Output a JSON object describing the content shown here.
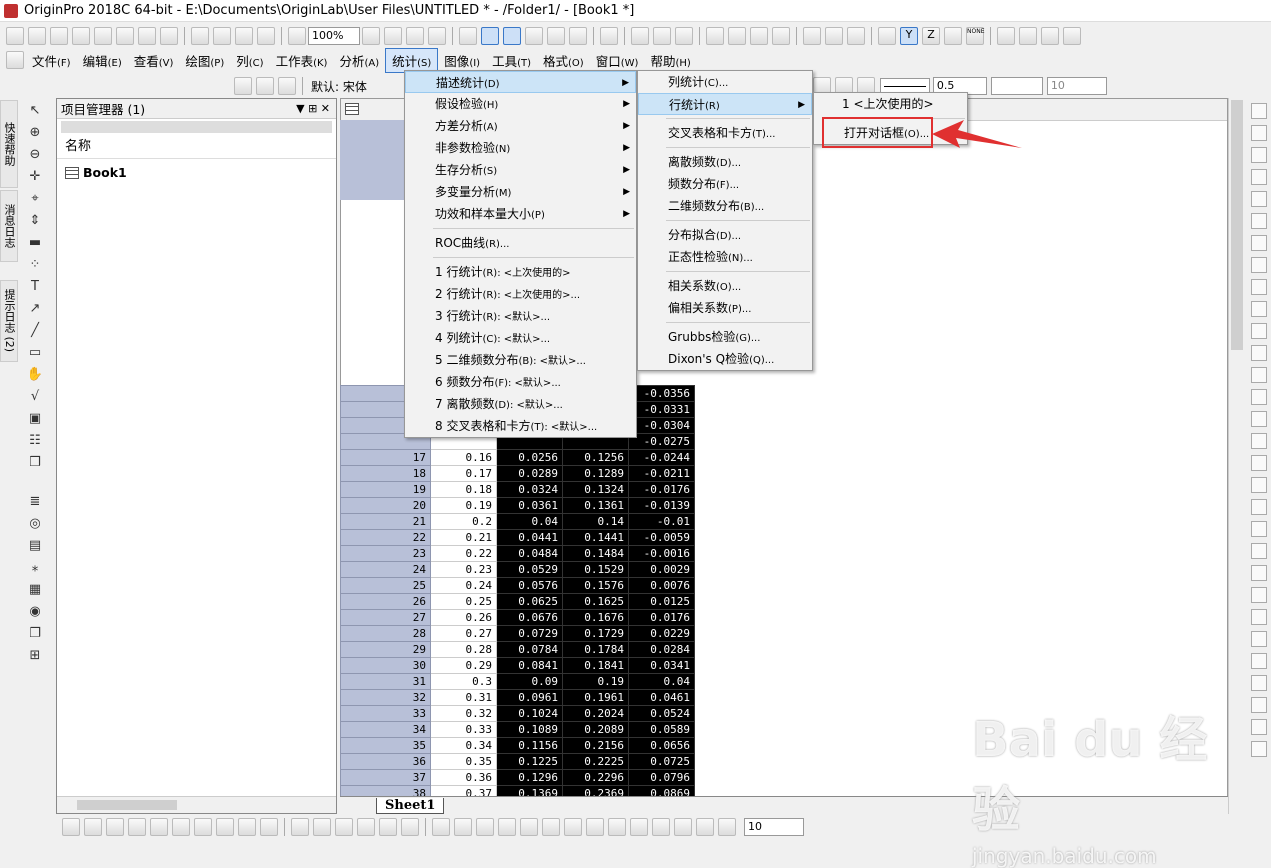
{
  "window": {
    "title": "OriginPro 2018C 64-bit - E:\\Documents\\OriginLab\\User Files\\UNTITLED * - /Folder1/ - [Book1 *]"
  },
  "toolbar": {
    "zoom": "100%",
    "font_name": "默认: 宋体",
    "line_width": "0.5",
    "bottom_size": "10",
    "letter_z": "Z",
    "letter_y": "Y",
    "none_label": "NONE"
  },
  "menubar": [
    {
      "label": "文件",
      "key": "(F)"
    },
    {
      "label": "编辑",
      "key": "(E)"
    },
    {
      "label": "查看",
      "key": "(V)"
    },
    {
      "label": "绘图",
      "key": "(P)"
    },
    {
      "label": "列",
      "key": "(C)"
    },
    {
      "label": "工作表",
      "key": "(K)"
    },
    {
      "label": "分析",
      "key": "(A)"
    },
    {
      "label": "统计",
      "key": "(S)"
    },
    {
      "label": "图像",
      "key": "(I)"
    },
    {
      "label": "工具",
      "key": "(T)"
    },
    {
      "label": "格式",
      "key": "(O)"
    },
    {
      "label": "窗口",
      "key": "(W)"
    },
    {
      "label": "帮助",
      "key": "(H)"
    }
  ],
  "side_tabs": [
    "快速帮助",
    "消息日志",
    "提示日志 (2)"
  ],
  "project_manager": {
    "title": "项目管理器 (1)",
    "column": "名称",
    "item": "Book1"
  },
  "worksheet": {
    "sheet_tab": "Sheet1",
    "rows": [
      {
        "r": "",
        "a": "",
        "b": "",
        "c": "",
        "d": "-0.0356"
      },
      {
        "r": "",
        "a": "",
        "b": "",
        "c": "",
        "d": "-0.0331"
      },
      {
        "r": "",
        "a": "",
        "b": "",
        "c": "",
        "d": "-0.0304"
      },
      {
        "r": "",
        "a": "",
        "b": "",
        "c": "",
        "d": "-0.0275"
      },
      {
        "r": "17",
        "a": "0.16",
        "b": "0.0256",
        "c": "0.1256",
        "d": "-0.0244"
      },
      {
        "r": "18",
        "a": "0.17",
        "b": "0.0289",
        "c": "0.1289",
        "d": "-0.0211"
      },
      {
        "r": "19",
        "a": "0.18",
        "b": "0.0324",
        "c": "0.1324",
        "d": "-0.0176"
      },
      {
        "r": "20",
        "a": "0.19",
        "b": "0.0361",
        "c": "0.1361",
        "d": "-0.0139"
      },
      {
        "r": "21",
        "a": "0.2",
        "b": "0.04",
        "c": "0.14",
        "d": "-0.01"
      },
      {
        "r": "22",
        "a": "0.21",
        "b": "0.0441",
        "c": "0.1441",
        "d": "-0.0059"
      },
      {
        "r": "23",
        "a": "0.22",
        "b": "0.0484",
        "c": "0.1484",
        "d": "-0.0016"
      },
      {
        "r": "24",
        "a": "0.23",
        "b": "0.0529",
        "c": "0.1529",
        "d": "0.0029"
      },
      {
        "r": "25",
        "a": "0.24",
        "b": "0.0576",
        "c": "0.1576",
        "d": "0.0076"
      },
      {
        "r": "26",
        "a": "0.25",
        "b": "0.0625",
        "c": "0.1625",
        "d": "0.0125"
      },
      {
        "r": "27",
        "a": "0.26",
        "b": "0.0676",
        "c": "0.1676",
        "d": "0.0176"
      },
      {
        "r": "28",
        "a": "0.27",
        "b": "0.0729",
        "c": "0.1729",
        "d": "0.0229"
      },
      {
        "r": "29",
        "a": "0.28",
        "b": "0.0784",
        "c": "0.1784",
        "d": "0.0284"
      },
      {
        "r": "30",
        "a": "0.29",
        "b": "0.0841",
        "c": "0.1841",
        "d": "0.0341"
      },
      {
        "r": "31",
        "a": "0.3",
        "b": "0.09",
        "c": "0.19",
        "d": "0.04"
      },
      {
        "r": "32",
        "a": "0.31",
        "b": "0.0961",
        "c": "0.1961",
        "d": "0.0461"
      },
      {
        "r": "33",
        "a": "0.32",
        "b": "0.1024",
        "c": "0.2024",
        "d": "0.0524"
      },
      {
        "r": "34",
        "a": "0.33",
        "b": "0.1089",
        "c": "0.2089",
        "d": "0.0589"
      },
      {
        "r": "35",
        "a": "0.34",
        "b": "0.1156",
        "c": "0.2156",
        "d": "0.0656"
      },
      {
        "r": "36",
        "a": "0.35",
        "b": "0.1225",
        "c": "0.2225",
        "d": "0.0725"
      },
      {
        "r": "37",
        "a": "0.36",
        "b": "0.1296",
        "c": "0.2296",
        "d": "0.0796"
      },
      {
        "r": "38",
        "a": "0.37",
        "b": "0.1369",
        "c": "0.2369",
        "d": "0.0869"
      }
    ]
  },
  "stats_menu": [
    {
      "label": "描述统计",
      "key": "(D)",
      "sub": true
    },
    {
      "label": "假设检验",
      "key": "(H)",
      "sub": true
    },
    {
      "label": "方差分析",
      "key": "(A)",
      "sub": true
    },
    {
      "label": "非参数检验",
      "key": "(N)",
      "sub": true
    },
    {
      "label": "生存分析",
      "key": "(S)",
      "sub": true
    },
    {
      "label": "多变量分析",
      "key": "(M)",
      "sub": true
    },
    {
      "label": "功效和样本量大小",
      "key": "(P)",
      "sub": true
    },
    {
      "sep": true
    },
    {
      "label": "ROC曲线",
      "key": "(R)...",
      "sub": false
    },
    {
      "sep": true
    },
    {
      "label": "1 行统计",
      "key": "(R): <上次使用的>",
      "sub": false
    },
    {
      "label": "2 行统计",
      "key": "(R): <上次使用的>...",
      "sub": false
    },
    {
      "label": "3 行统计",
      "key": "(R): <默认>...",
      "sub": false
    },
    {
      "label": "4 列统计",
      "key": "(C): <默认>...",
      "sub": false
    },
    {
      "label": "5 二维频数分布",
      "key": "(B): <默认>...",
      "sub": false
    },
    {
      "label": "6 频数分布",
      "key": "(F): <默认>...",
      "sub": false
    },
    {
      "label": "7 离散频数",
      "key": "(D): <默认>...",
      "sub": false
    },
    {
      "label": "8 交叉表格和卡方",
      "key": "(T): <默认>...",
      "sub": false
    }
  ],
  "desc_menu": [
    {
      "label": "列统计",
      "key": "(C)...",
      "sub": false
    },
    {
      "label": "行统计",
      "key": "(R)",
      "sub": true
    },
    {
      "sep": true
    },
    {
      "label": "交叉表格和卡方",
      "key": "(T)...",
      "sub": false
    },
    {
      "sep": true
    },
    {
      "label": "离散频数",
      "key": "(D)...",
      "sub": false
    },
    {
      "label": "频数分布",
      "key": "(F)...",
      "sub": false
    },
    {
      "label": "二维频数分布",
      "key": "(B)...",
      "sub": false
    },
    {
      "sep": true
    },
    {
      "label": "分布拟合",
      "key": "(D)...",
      "sub": false
    },
    {
      "label": "正态性检验",
      "key": "(N)...",
      "sub": false
    },
    {
      "sep": true
    },
    {
      "label": "相关系数",
      "key": "(O)...",
      "sub": false
    },
    {
      "label": "偏相关系数",
      "key": "(P)...",
      "sub": false
    },
    {
      "sep": true
    },
    {
      "label": "Grubbs检验",
      "key": "(G)...",
      "sub": false
    },
    {
      "label": "Dixon's Q检验",
      "key": "(Q)...",
      "sub": false
    }
  ],
  "row_menu": [
    {
      "label": "1 <上次使用的>",
      "key": "",
      "sub": false
    },
    {
      "sep": true
    },
    {
      "label": "打开对话框",
      "key": "(O)...",
      "sub": false
    }
  ],
  "watermark": {
    "brand": "Bai du 经验",
    "url": "jingyan.baidu.com"
  },
  "colors": {
    "menu_highlight": "#cce4f7",
    "annotation_red": "#e03030",
    "row_header": "#b8c0d8"
  }
}
